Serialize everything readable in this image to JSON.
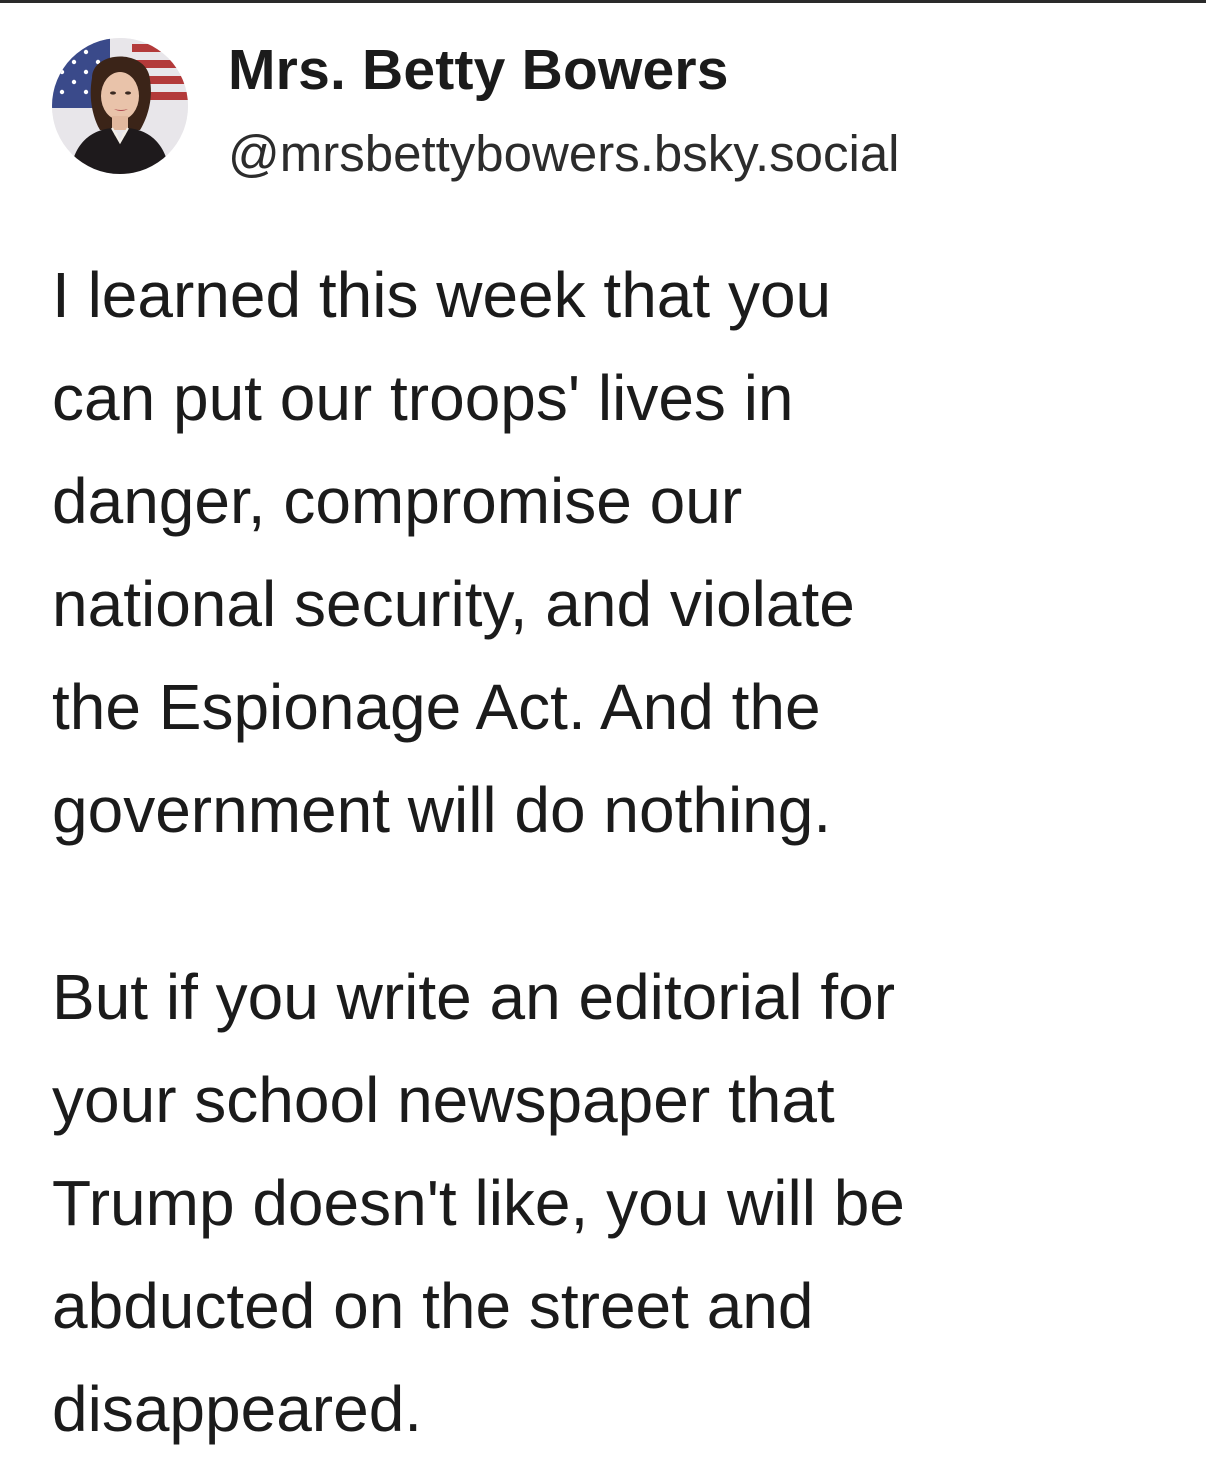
{
  "author": {
    "display_name": "Mrs. Betty Bowers",
    "handle": "@mrsbettybowers.bsky.social",
    "avatar_icon": "profile-photo-avatar-icon"
  },
  "post": {
    "paragraphs": [
      {
        "lines": [
          "I learned this week that you",
          "can put our troops' lives in",
          "danger, compromise our",
          "national security, and violate",
          "the Espionage Act. And the",
          "government will do nothing."
        ]
      },
      {
        "lines": [
          "But if you write an editorial for",
          "your school newspaper that",
          "Trump doesn't like, you will be",
          "abducted on the street and",
          "disappeared."
        ]
      }
    ]
  },
  "colors": {
    "text": "#1b1b1b",
    "background": "#ffffff",
    "rule": "#2a2a2a"
  }
}
